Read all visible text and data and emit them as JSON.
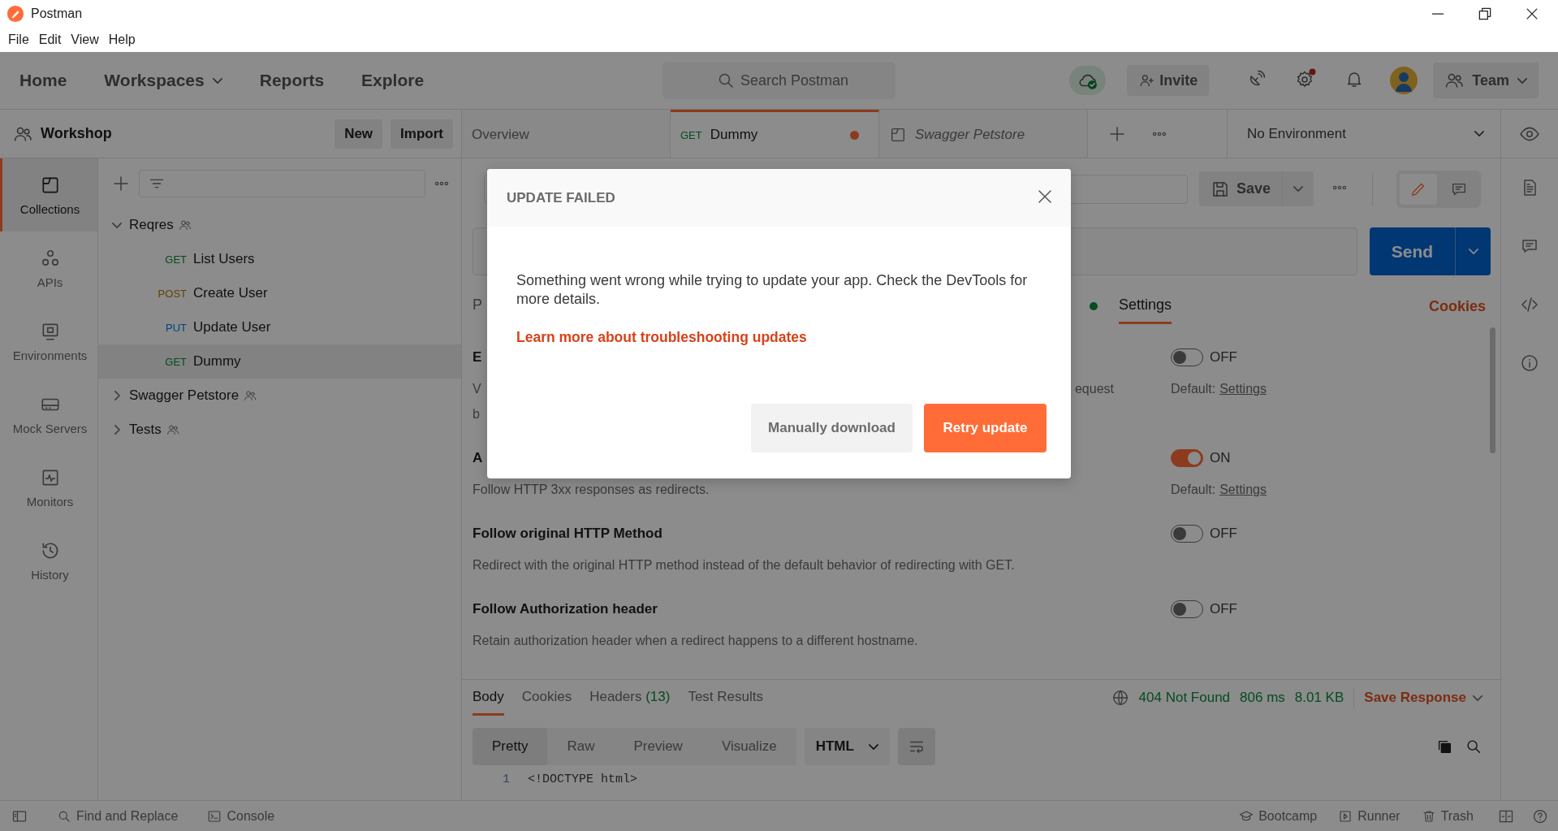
{
  "window": {
    "title": "Postman"
  },
  "menu": [
    "File",
    "Edit",
    "View",
    "Help"
  ],
  "nav": {
    "items": [
      {
        "label": "Home",
        "dropdown": false
      },
      {
        "label": "Workspaces",
        "dropdown": true
      },
      {
        "label": "Reports",
        "dropdown": false
      },
      {
        "label": "Explore",
        "dropdown": false
      }
    ],
    "search": {
      "placeholder": "Search Postman"
    },
    "invite": "Invite",
    "team": "Team"
  },
  "workspace": {
    "name": "Workshop",
    "buttons": [
      "New",
      "Import"
    ]
  },
  "rail": [
    {
      "kind": "collections",
      "label": "Collections",
      "selected": true
    },
    {
      "kind": "apis",
      "label": "APIs",
      "selected": false
    },
    {
      "kind": "environments",
      "label": "Environments",
      "selected": false
    },
    {
      "kind": "mock_servers",
      "label": "Mock Servers",
      "selected": false
    },
    {
      "kind": "monitors",
      "label": "Monitors",
      "selected": false
    },
    {
      "kind": "history",
      "label": "History",
      "selected": false
    }
  ],
  "tree": [
    {
      "name": "Reqres",
      "expanded": true,
      "children": [
        {
          "method": "GET",
          "name": "List Users",
          "selected": false
        },
        {
          "method": "POST",
          "name": "Create User",
          "selected": false
        },
        {
          "method": "PUT",
          "name": "Update User",
          "selected": false
        },
        {
          "method": "GET",
          "name": "Dummy",
          "selected": true
        }
      ]
    },
    {
      "name": "Swagger Petstore",
      "expanded": false
    },
    {
      "name": "Tests",
      "expanded": false
    }
  ],
  "tabs": [
    {
      "kind": "overview",
      "label": "Overview",
      "selected": false
    },
    {
      "kind": "request",
      "method": "GET",
      "label": "Dummy",
      "selected": true,
      "unsaved": true
    },
    {
      "kind": "collection",
      "label": "Swagger Petstore",
      "selected": false,
      "preview": true
    }
  ],
  "environment": "No Environment",
  "request": {
    "save": "Save",
    "send": "Send",
    "tabs": [
      {
        "label": "P",
        "selected": false
      },
      {
        "label": "Settings",
        "selected": true
      }
    ],
    "cookies": "Cookies"
  },
  "settings": [
    {
      "title": "E",
      "description": [
        "V",
        "equest"
      ],
      "description_line_2": "b",
      "on": false,
      "state_label": "OFF",
      "default_label": "Default:",
      "default_link": "Settings"
    },
    {
      "title": "A",
      "description": [
        "Follow HTTP 3xx responses as redirects."
      ],
      "on": true,
      "state_label": "ON",
      "default_label": "Default:",
      "default_link": "Settings"
    },
    {
      "title": "Follow original HTTP Method",
      "description": [
        "Redirect with the original HTTP method instead of the default behavior of redirecting with GET."
      ],
      "on": false,
      "state_label": "OFF"
    },
    {
      "title": "Follow Authorization header",
      "description": [
        "Retain authorization header when a redirect happens to a different hostname."
      ],
      "on": false,
      "state_label": "OFF"
    }
  ],
  "response": {
    "tabs": [
      {
        "label": "Body",
        "selected": true
      },
      {
        "label": "Cookies",
        "selected": false
      },
      {
        "label": "Headers",
        "count": "(13)",
        "selected": false
      },
      {
        "label": "Test Results",
        "selected": false
      }
    ],
    "status": "404 Not Found",
    "time": "806 ms",
    "size": "8.01 KB",
    "save": "Save Response",
    "formats": [
      {
        "label": "Pretty",
        "selected": true
      },
      {
        "label": "Raw",
        "selected": false
      },
      {
        "label": "Preview",
        "selected": false
      },
      {
        "label": "Visualize",
        "selected": false
      }
    ],
    "language": "HTML",
    "code": [
      {
        "line": "1",
        "text": "<!DOCTYPE html>"
      }
    ]
  },
  "status_bar": {
    "left": [
      {
        "kind": "find",
        "label": "Find and Replace"
      },
      {
        "kind": "console",
        "label": "Console"
      }
    ],
    "right": [
      {
        "kind": "bootcamp",
        "label": "Bootcamp"
      },
      {
        "kind": "runner",
        "label": "Runner"
      },
      {
        "kind": "trash",
        "label": "Trash"
      }
    ]
  },
  "dialog": {
    "title": "UPDATE FAILED",
    "message": "Something went wrong while trying to update your app. Check the DevTools for more details.",
    "link": "Learn more about troubleshooting updates",
    "buttons": [
      {
        "kind": "secondary",
        "label": "Manually download"
      },
      {
        "kind": "primary",
        "label": "Retry update"
      }
    ]
  }
}
